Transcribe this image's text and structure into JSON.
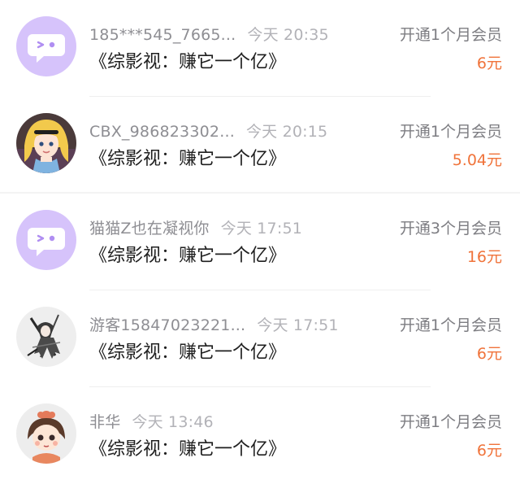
{
  "colors": {
    "amount": "#f0733a",
    "username": "#8e8e93",
    "time": "#b2b2b7",
    "title": "#1f1f1f",
    "default_avatar_bg": "#d6c3fb"
  },
  "transactions": [
    {
      "avatar_icon": "default-chat-bubble-avatar",
      "username": "185***545_7665...",
      "time": "今天 20:35",
      "work": "《综影视：赚它一个亿》",
      "action": "开通1个月会员",
      "amount": "6元"
    },
    {
      "avatar_icon": "cartoon-blonde-girl-avatar",
      "username": "CBX_986823302...",
      "time": "今天 20:15",
      "work": "《综影视：赚它一个亿》",
      "action": "开通1个月会员",
      "amount": "5.04元"
    },
    {
      "avatar_icon": "default-chat-bubble-avatar",
      "username": "猫猫Z也在凝视你",
      "time": "今天 17:51",
      "work": "《综影视：赚它一个亿》",
      "action": "开通3个月会员",
      "amount": "16元"
    },
    {
      "avatar_icon": "anime-character-sketch-avatar",
      "username": "游客15847023221...",
      "time": "今天 17:51",
      "work": "《综影视：赚它一个亿》",
      "action": "开通1个月会员",
      "amount": "6元"
    },
    {
      "avatar_icon": "cartoon-girl-bow-avatar",
      "username": "非华",
      "time": "今天 13:46",
      "work": "《综影视：赚它一个亿》",
      "action": "开通1个月会员",
      "amount": "6元"
    }
  ]
}
